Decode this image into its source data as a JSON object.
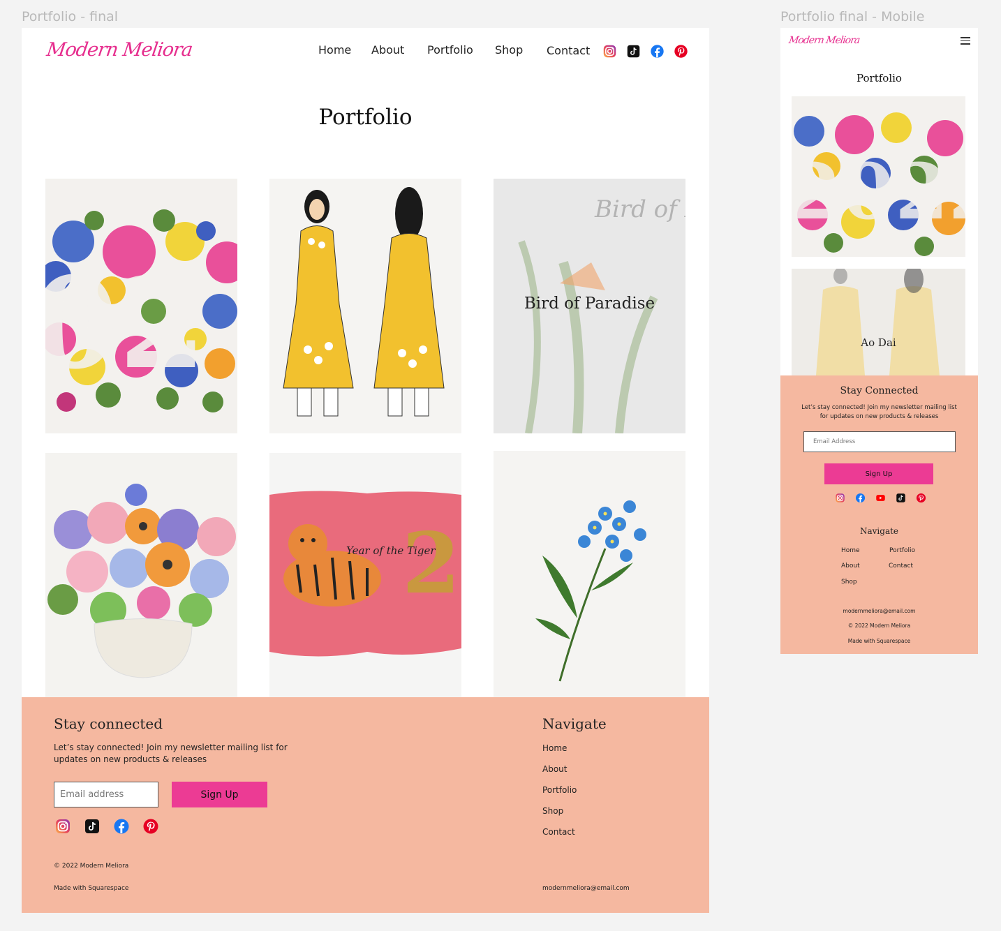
{
  "frames": {
    "desktop_label": "Portfolio - final",
    "mobile_label": "Portfolio final - Mobile"
  },
  "brand": {
    "logo_text": "Modern Meliora",
    "accent": "#e62e8e",
    "footer_bg": "#f5b8a0",
    "button_bg": "#ec3b94"
  },
  "nav": {
    "items": [
      "Home",
      "About",
      "Portfolio",
      "Shop",
      "Contact"
    ],
    "social_icons": [
      "instagram-icon",
      "tiktok-icon",
      "facebook-icon",
      "pinterest-icon"
    ]
  },
  "page": {
    "title": "Portfolio"
  },
  "gallery": {
    "tiles": [
      {
        "name": "2022-floral-numbers",
        "overlay": ""
      },
      {
        "name": "ao-dai-illustration",
        "overlay": ""
      },
      {
        "name": "bird-of-paradise",
        "overlay": "Bird of Paradise",
        "script_text": "Bird of Paradise"
      },
      {
        "name": "flower-vase",
        "overlay": ""
      },
      {
        "name": "year-of-the-tiger",
        "overlay": "",
        "script_text": "Year of the Tiger"
      },
      {
        "name": "forget-me-not",
        "overlay": ""
      }
    ]
  },
  "footer": {
    "stay_title": "Stay connected",
    "stay_text_line1": "Let’s stay connected! Join my newsletter mailing list for",
    "stay_text_line2": "updates on new products & releases",
    "email_placeholder": "Email address",
    "signup_label": "Sign Up",
    "navigate_title": "Navigate",
    "navigate_items": [
      "Home",
      "About",
      "Portfolio",
      "Shop",
      "Contact"
    ],
    "copyright": "© 2022 Modern Meliora",
    "made_with": "Made with Squarespace",
    "email": "modernmeliora@email.com"
  },
  "mobile": {
    "page_title": "Portfolio",
    "tile2_label": "Ao Dai",
    "stay_title": "Stay Connected",
    "stay_text_line1": "Let’s stay connected! Join my newsletter mailing list",
    "stay_text_line2": "for updates on new products & releases",
    "email_placeholder": "Email Address",
    "signup_label": "Sign Up",
    "social_icons": [
      "instagram-icon",
      "facebook-icon",
      "youtube-icon",
      "tiktok-icon",
      "pinterest-icon"
    ],
    "navigate_title": "Navigate",
    "navigate_col1": [
      "Home",
      "About",
      "Shop"
    ],
    "navigate_col2": [
      "Portfolio",
      "Contact"
    ],
    "email": "modernmeliora@email.com",
    "copyright": "© 2022 Modern Meliora",
    "made_with": "Made with Squarespace"
  }
}
